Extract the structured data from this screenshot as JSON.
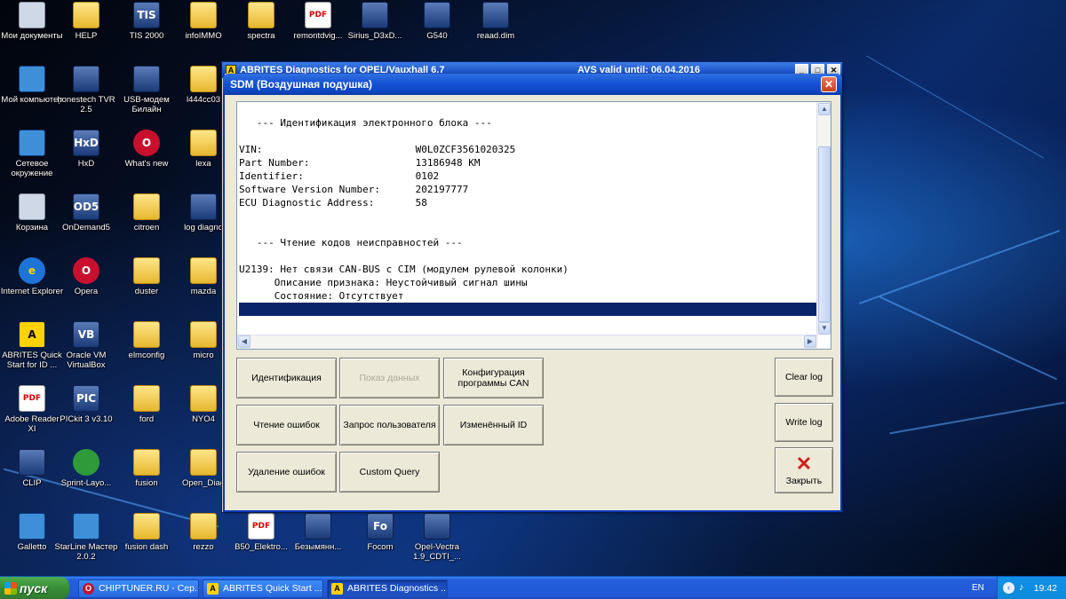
{
  "desktop_icons": [
    {
      "label": "Мои документы",
      "icon": "my-documents-icon"
    },
    {
      "label": "HELP",
      "icon": "folder-icon"
    },
    {
      "label": "TIS 2000",
      "icon": "tis-icon"
    },
    {
      "label": "infoIMMO",
      "icon": "folder-icon"
    },
    {
      "label": "spectra",
      "icon": "folder-icon"
    },
    {
      "label": "remontdvig...",
      "icon": "pdf-icon"
    },
    {
      "label": "Sirius_D3xD...",
      "icon": "archive-icon"
    },
    {
      "label": "G540",
      "icon": "app-icon"
    },
    {
      "label": "reaad.dim",
      "icon": "file-icon"
    },
    {
      "label": "Мой компьютер",
      "icon": "computer-icon"
    },
    {
      "label": "honestech TVR 2.5",
      "icon": "app-icon"
    },
    {
      "label": "USB-модем Билайн",
      "icon": "modem-icon"
    },
    {
      "label": "l444cc03",
      "icon": "folder-icon"
    },
    {
      "label": "Сетевое окружение",
      "icon": "network-icon"
    },
    {
      "label": "HxD",
      "icon": "hxd-icon"
    },
    {
      "label": "What's new",
      "icon": "opera-icon"
    },
    {
      "label": "lexa",
      "icon": "folder-icon"
    },
    {
      "label": "Корзина",
      "icon": "recycle-bin-icon"
    },
    {
      "label": "OnDemand5",
      "icon": "od5-icon"
    },
    {
      "label": "citroen",
      "icon": "folder-icon"
    },
    {
      "label": "log diagno",
      "icon": "file-icon"
    },
    {
      "label": "Internet Explorer",
      "icon": "ie-icon"
    },
    {
      "label": "Opera",
      "icon": "opera-icon"
    },
    {
      "label": "duster",
      "icon": "folder-icon"
    },
    {
      "label": "mazda",
      "icon": "folder-icon"
    },
    {
      "label": "ABRITES Quick Start for ID ...",
      "icon": "abrites-icon"
    },
    {
      "label": "Oracle VM VirtualBox",
      "icon": "virtualbox-icon"
    },
    {
      "label": "elmconfig",
      "icon": "folder-icon"
    },
    {
      "label": "micro",
      "icon": "folder-icon"
    },
    {
      "label": "Adobe Reader XI",
      "icon": "adobe-reader-icon"
    },
    {
      "label": "PICkit 3 v3.10",
      "icon": "pickit-icon"
    },
    {
      "label": "ford",
      "icon": "folder-icon"
    },
    {
      "label": "NYO4",
      "icon": "folder-icon"
    },
    {
      "label": "CLIP",
      "icon": "clip-icon"
    },
    {
      "label": "Sprint-Layo...",
      "icon": "sprint-layout-icon"
    },
    {
      "label": "fusion",
      "icon": "folder-icon"
    },
    {
      "label": "Open_Diag",
      "icon": "folder-icon"
    },
    {
      "label": "Galletto",
      "icon": "galletto-icon"
    },
    {
      "label": "StarLine Мастер 2.0.2",
      "icon": "starline-icon"
    },
    {
      "label": "fusion dash",
      "icon": "folder-icon"
    },
    {
      "label": "rezzo",
      "icon": "folder-icon"
    },
    {
      "label": "B50_Elektro...",
      "icon": "pdf-icon"
    },
    {
      "label": "Безымянн...",
      "icon": "image-icon"
    },
    {
      "label": "Focom",
      "icon": "focom-icon"
    },
    {
      "label": "Opel-Vectra 1.9_CDTI_...",
      "icon": "file-icon"
    }
  ],
  "background_window": {
    "title": "ABRITES Diagnostics for OPEL/Vauxhall 6.7",
    "validity": "AVS valid until: 06.04.2016"
  },
  "dialog": {
    "title": "SDM (Воздушная подушка)",
    "output_lines": [
      "   --- Идентификация электронного блока ---",
      "",
      "VIN:                          W0L0ZCF3561020325",
      "Part Number:                  13186948 KM",
      "Identifier:                   0102",
      "Software Version Number:      202197777",
      "ECU Diagnostic Address:       58",
      "",
      "",
      "   --- Чтение кодов неисправностей ---",
      "",
      "U2139: Нет связи CAN-BUS с CIM (модулем рулевой колонки)",
      "      Описание признака: Неустойчивый сигнал шины",
      "      Состояние: Отсутствует",
      ""
    ],
    "buttons": {
      "identification": "Идентификация",
      "show_data": "Показ данных",
      "can_config": "Конфигурация программы CAN",
      "read_errors": "Чтение ошибок",
      "user_request": "Запрос пользователя",
      "changed_id": "Изменённый ID",
      "clear_errors": "Удаление ошибок",
      "custom_query": "Custom Query",
      "clear_log": "Clear log",
      "write_log": "Write log",
      "close": "Закрыть"
    }
  },
  "taskbar": {
    "start": "пуск",
    "tasks": [
      {
        "label": "CHIPTUNER.RU - Сер...",
        "icon": "opera-icon",
        "active": false
      },
      {
        "label": "ABRITES Quick Start ...",
        "icon": "abrites-icon",
        "active": false
      },
      {
        "label": "ABRITES Diagnostics ...",
        "icon": "abrites-icon",
        "active": true
      }
    ],
    "language": "EN",
    "time": "19:42"
  },
  "colors": {
    "selection": "#0a246a",
    "titlebar": "#1653d6",
    "taskbar": "#245edb",
    "start_button": "#378d37"
  }
}
